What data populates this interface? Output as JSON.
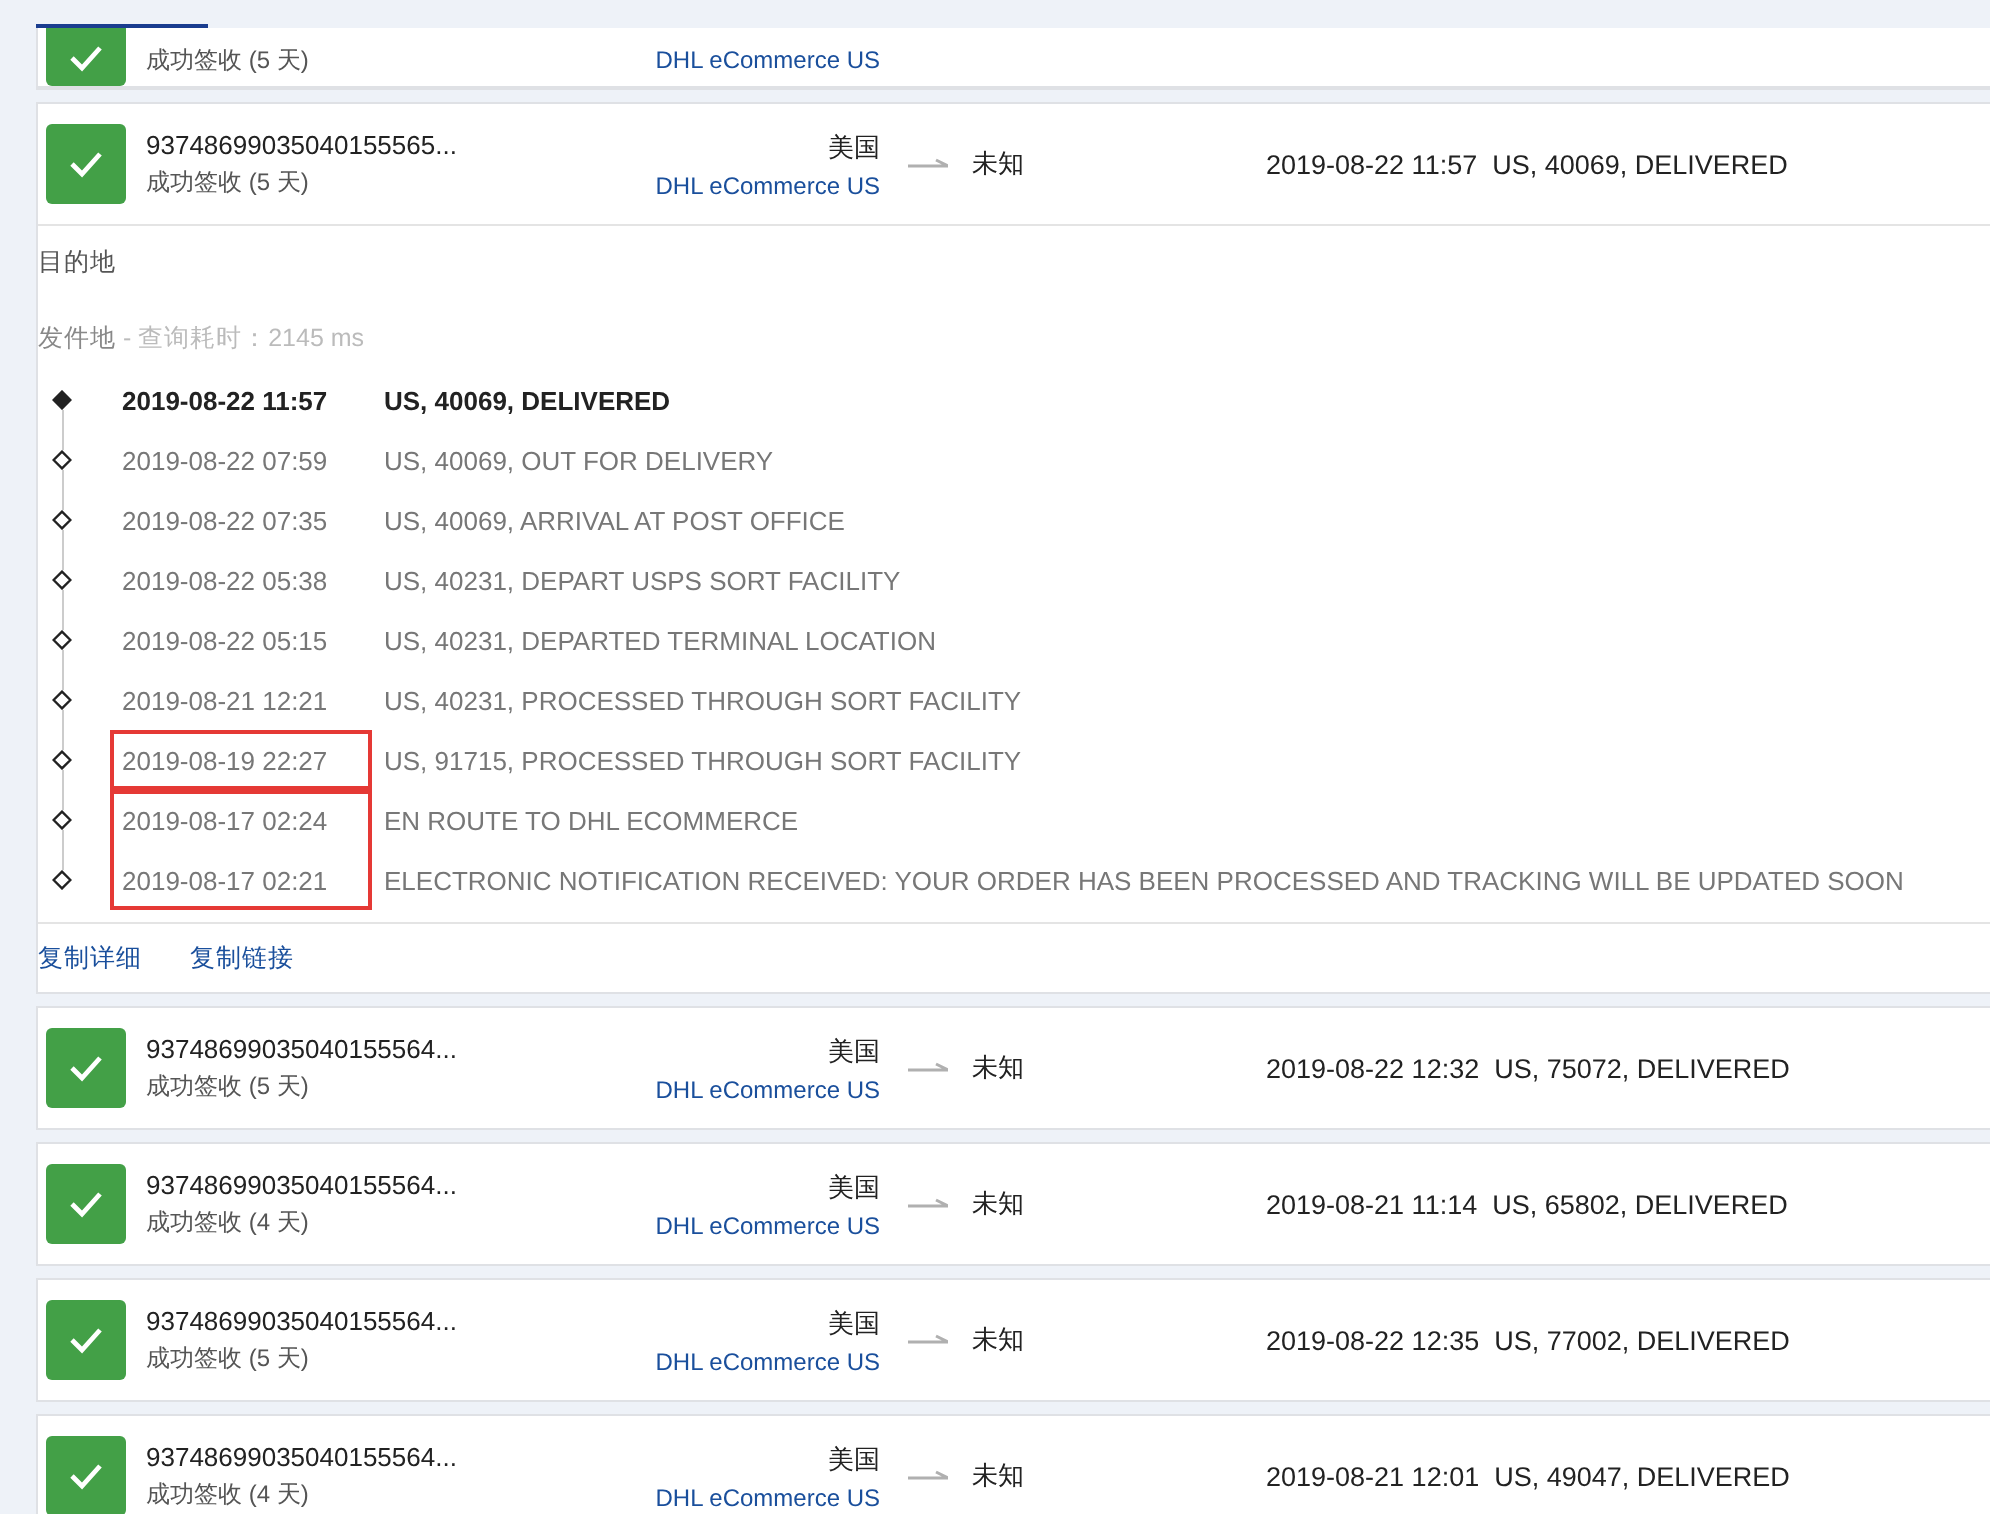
{
  "top_card": {
    "status": "成功签收 (5 天)",
    "carrier": "DHL eCommerce US"
  },
  "expanded": {
    "number": "93748699035040155565...",
    "status": "成功签收 (5 天)",
    "origin": "美国",
    "carrier": "DHL eCommerce US",
    "destination": "未知",
    "latest": "2019-08-22 11:57  US, 40069, DELIVERED",
    "dest_label": "目的地",
    "origin_label": "发件地",
    "query_time": " - 查询耗时：2145 ms",
    "groups": [
      {
        "boxed": false,
        "events": [
          {
            "time": "2019-08-22 11:57",
            "text": "US, 40069, DELIVERED",
            "latest": true
          },
          {
            "time": "2019-08-22 07:59",
            "text": "US, 40069, OUT FOR DELIVERY",
            "latest": false
          },
          {
            "time": "2019-08-22 07:35",
            "text": "US, 40069, ARRIVAL AT POST OFFICE",
            "latest": false
          },
          {
            "time": "2019-08-22 05:38",
            "text": "US, 40231, DEPART USPS SORT FACILITY",
            "latest": false
          },
          {
            "time": "2019-08-22 05:15",
            "text": "US, 40231, DEPARTED TERMINAL LOCATION",
            "latest": false
          },
          {
            "time": "2019-08-21 12:21",
            "text": "US, 40231, PROCESSED THROUGH SORT FACILITY",
            "latest": false
          }
        ]
      },
      {
        "boxed": true,
        "events": [
          {
            "time": "2019-08-19 22:27",
            "text": "US, 91715, PROCESSED THROUGH SORT FACILITY",
            "latest": false
          }
        ]
      },
      {
        "boxed": true,
        "events": [
          {
            "time": "2019-08-17 02:24",
            "text": "EN ROUTE TO DHL ECOMMERCE",
            "latest": false
          },
          {
            "time": "2019-08-17 02:21",
            "text": "ELECTRONIC NOTIFICATION RECEIVED: YOUR ORDER HAS BEEN PROCESSED AND TRACKING WILL BE UPDATED SOON",
            "latest": false
          }
        ]
      }
    ],
    "actions": [
      "复制详细",
      "复制链接"
    ]
  },
  "cards": [
    {
      "number": "93748699035040155564...",
      "status": "成功签收 (5 天)",
      "origin": "美国",
      "carrier": "DHL eCommerce US",
      "destination": "未知",
      "latest": "2019-08-22 12:32  US, 75072, DELIVERED"
    },
    {
      "number": "93748699035040155564...",
      "status": "成功签收 (4 天)",
      "origin": "美国",
      "carrier": "DHL eCommerce US",
      "destination": "未知",
      "latest": "2019-08-21 11:14  US, 65802, DELIVERED"
    },
    {
      "number": "93748699035040155564...",
      "status": "成功签收 (5 天)",
      "origin": "美国",
      "carrier": "DHL eCommerce US",
      "destination": "未知",
      "latest": "2019-08-22 12:35  US, 77002, DELIVERED"
    },
    {
      "number": "93748699035040155564...",
      "status": "成功签收 (4 天)",
      "origin": "美国",
      "carrier": "DHL eCommerce US",
      "destination": "未知",
      "latest": "2019-08-21 12:01  US, 49047, DELIVERED"
    }
  ]
}
